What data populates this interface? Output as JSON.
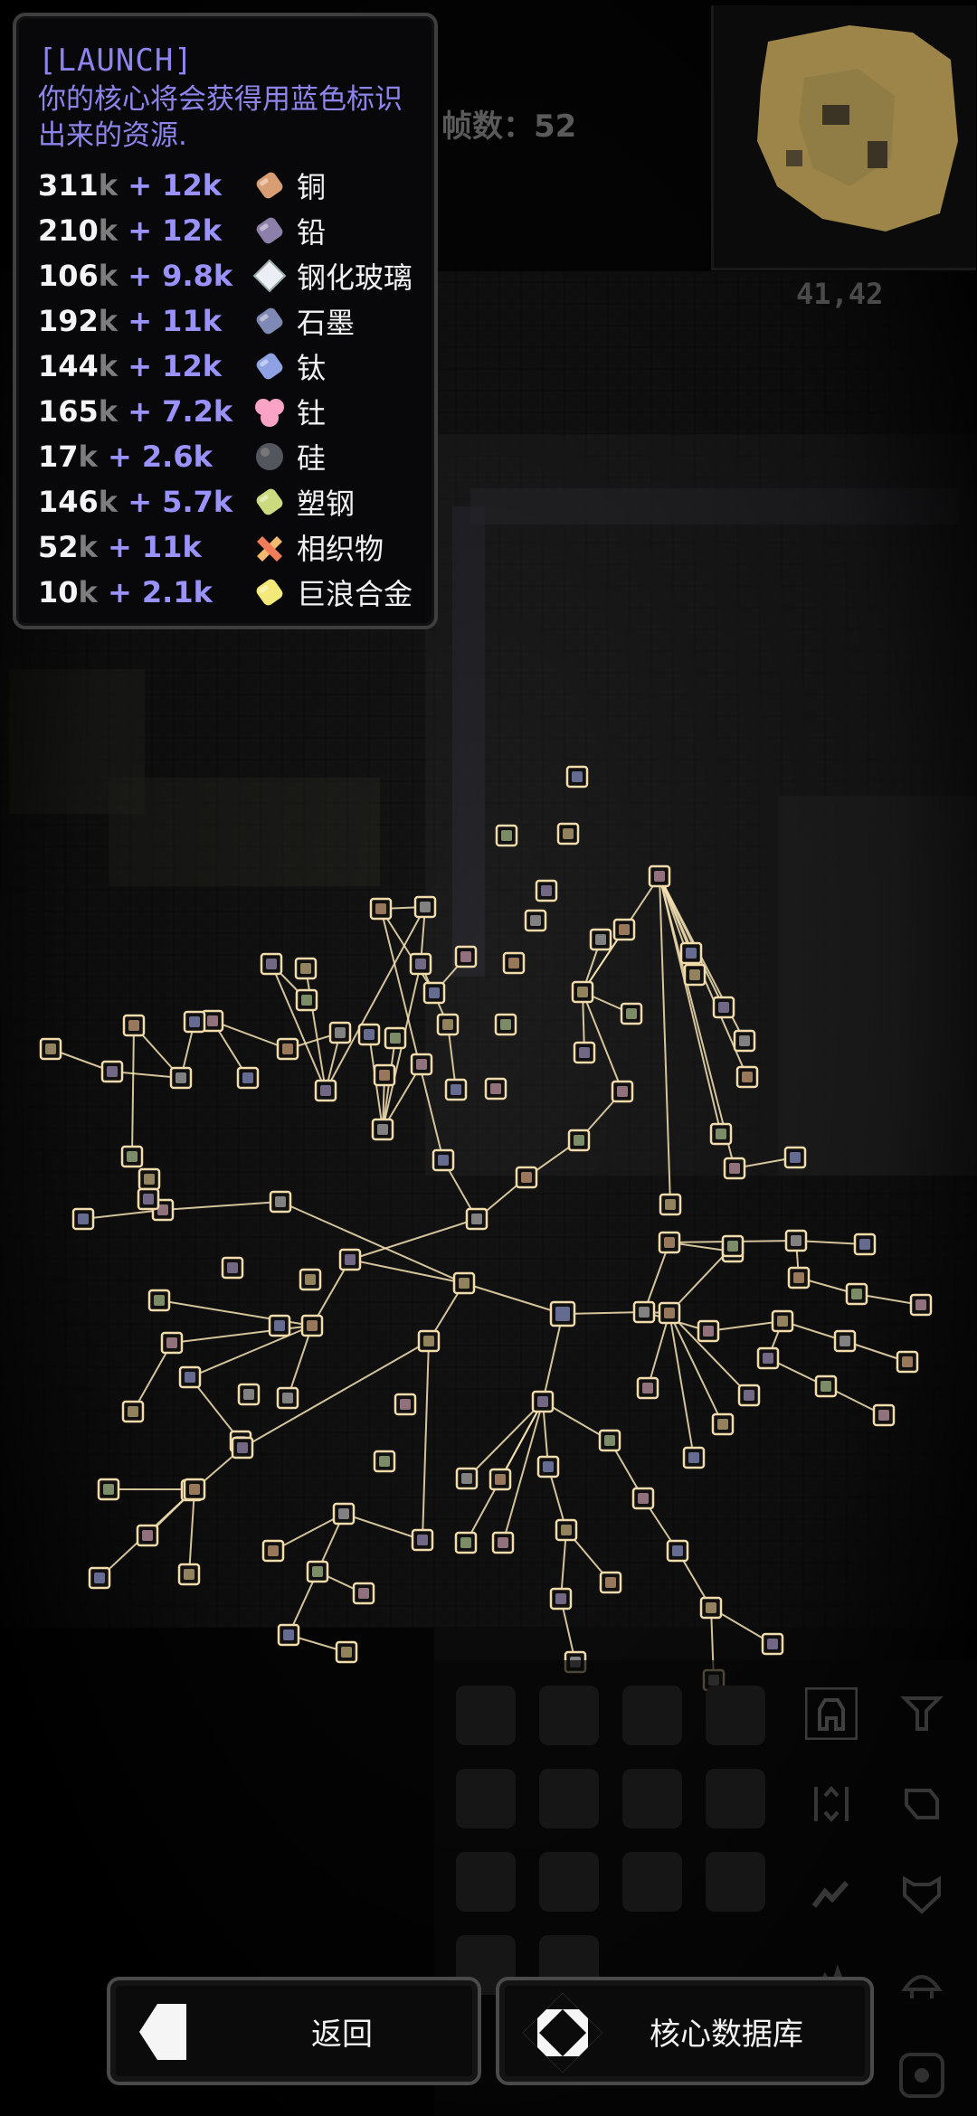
{
  "launch_panel": {
    "title": "[LAUNCH]",
    "description": "你的核心将会获得用蓝色标识出来的资源.",
    "resources": [
      {
        "amount": "311",
        "unit": "k",
        "gain": "+ 12k",
        "name": "铜",
        "icon": "copper-icon",
        "color": "#d99d73"
      },
      {
        "amount": "210",
        "unit": "k",
        "gain": "+ 12k",
        "name": "铅",
        "icon": "lead-icon",
        "color": "#8c7fa9"
      },
      {
        "amount": "106",
        "unit": "k",
        "gain": "+ 9.8k",
        "name": "钢化玻璃",
        "icon": "metaglass-icon",
        "color": "#ebeef5"
      },
      {
        "amount": "192",
        "unit": "k",
        "gain": "+ 11k",
        "name": "石墨",
        "icon": "graphite-icon",
        "color": "#7e89b5"
      },
      {
        "amount": "144",
        "unit": "k",
        "gain": "+ 12k",
        "name": "钛",
        "icon": "titanium-icon",
        "color": "#8da1e3"
      },
      {
        "amount": "165",
        "unit": "k",
        "gain": "+ 7.2k",
        "name": "钍",
        "icon": "thorium-icon",
        "color": "#f9a3c7"
      },
      {
        "amount": "17",
        "unit": "k",
        "gain": "+ 2.6k",
        "name": "硅",
        "icon": "silicon-icon",
        "color": "#53565c"
      },
      {
        "amount": "146",
        "unit": "k",
        "gain": "+ 5.7k",
        "name": "塑钢",
        "icon": "plastanium-icon",
        "color": "#cbd97f"
      },
      {
        "amount": "52",
        "unit": "k",
        "gain": "+ 11k",
        "name": "相织物",
        "icon": "phase-fabric-icon",
        "color": "#f4ba6e"
      },
      {
        "amount": "10",
        "unit": "k",
        "gain": "+ 2.1k",
        "name": "巨浪合金",
        "icon": "surge-alloy-icon",
        "color": "#f3e979"
      }
    ]
  },
  "hud": {
    "fps_label": "帧数：52",
    "coords": "41,42"
  },
  "buttons": {
    "back_label": "返回",
    "database_label": "核心数据库"
  },
  "colors": {
    "accent": "#8d85ec",
    "tree_line": "#f6e3b3",
    "node_border": "#f3dcab",
    "node_fill": "#111111"
  }
}
